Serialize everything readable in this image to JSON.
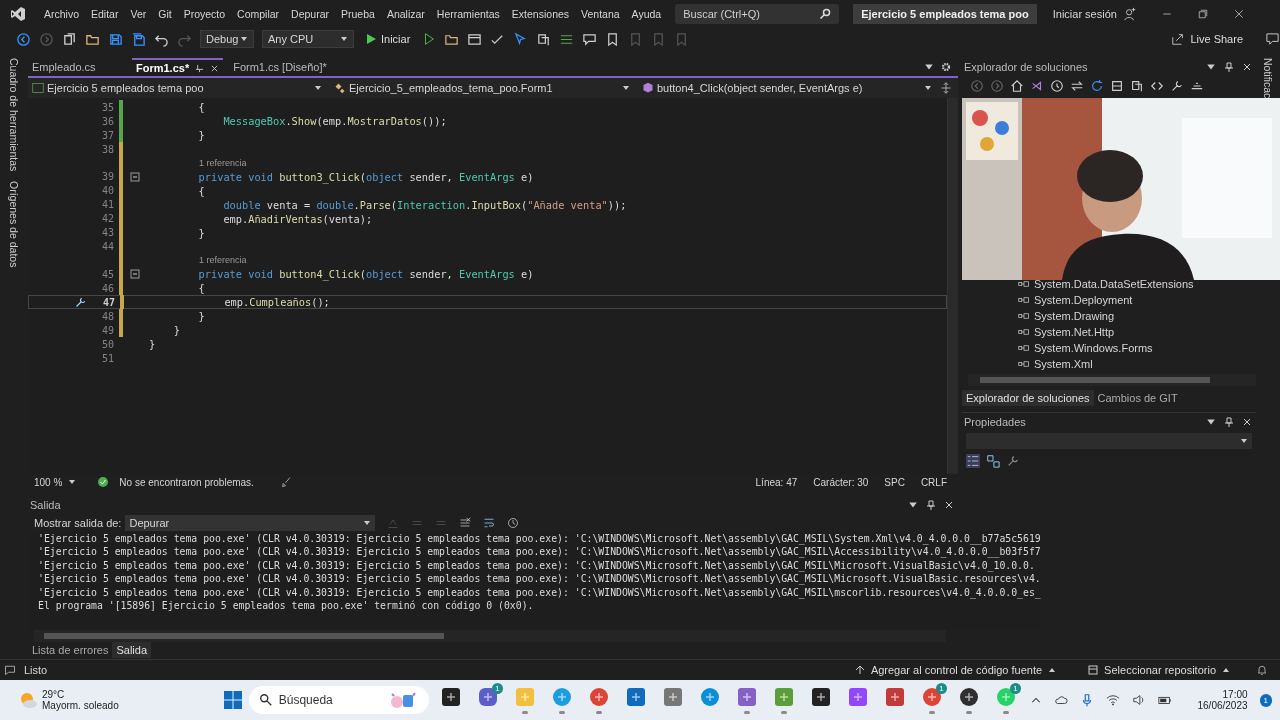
{
  "menu_bar": {
    "items": [
      "Archivo",
      "Editar",
      "Ver",
      "Git",
      "Proyecto",
      "Compilar",
      "Depurar",
      "Prueba",
      "Analizar",
      "Herramientas",
      "Extensiones",
      "Ventana",
      "Ayuda"
    ],
    "search": {
      "placeholder": "Buscar (Ctrl+Q)"
    },
    "solution_name": "Ejercicio 5 empleados tema poo",
    "sign_in": "Iniciar sesión"
  },
  "toolbar": {
    "configuration": "Debug",
    "platform": "Any CPU",
    "start": "Iniciar",
    "live_share": "Live Share"
  },
  "left_rail": [
    "Cuadro de herramientas",
    "Orígenes de datos"
  ],
  "editor": {
    "tabs": [
      {
        "label": "Empleado.cs",
        "selected": false
      },
      {
        "label": "Form1.cs*",
        "selected": true
      },
      {
        "label": "Form1.cs [Diseño]*",
        "selected": false
      }
    ],
    "nav": {
      "project": "Ejercicio 5 empleados tema poo",
      "class": "Ejercicio_5_empleados_tema_poo.Form1",
      "member": "button4_Click(object sender, EventArgs e)"
    },
    "lines": [
      {
        "kind": "code",
        "number": "35",
        "current": false,
        "fold": false,
        "changed": true,
        "saved": true,
        "tokens": [
          {
            "kind": "plain",
            "text": "        {"
          }
        ]
      },
      {
        "kind": "code",
        "number": "36",
        "current": false,
        "fold": false,
        "changed": true,
        "saved": true,
        "tokens": [
          {
            "kind": "type",
            "text": "            MessageBox"
          },
          {
            "kind": "plain",
            "text": "."
          },
          {
            "kind": "method",
            "text": "Show"
          },
          {
            "kind": "plain",
            "text": "(emp."
          },
          {
            "kind": "method",
            "text": "MostrarDatos"
          },
          {
            "kind": "plain",
            "text": "());"
          }
        ]
      },
      {
        "kind": "code",
        "number": "37",
        "current": false,
        "fold": false,
        "changed": true,
        "saved": true,
        "tokens": [
          {
            "kind": "plain",
            "text": "        }"
          }
        ]
      },
      {
        "kind": "code",
        "number": "38",
        "current": false,
        "fold": false,
        "changed": true,
        "saved": false
      },
      {
        "kind": "codelens",
        "text": "1 referencia"
      },
      {
        "kind": "code",
        "number": "39",
        "current": false,
        "fold": true,
        "changed": true,
        "saved": false,
        "tokens": [
          {
            "kind": "keyword",
            "text": "        private void "
          },
          {
            "kind": "method",
            "text": "button3_Click"
          },
          {
            "kind": "plain",
            "text": "("
          },
          {
            "kind": "keyword",
            "text": "object"
          },
          {
            "kind": "plain",
            "text": " sender, "
          },
          {
            "kind": "type",
            "text": "EventArgs"
          },
          {
            "kind": "plain",
            "text": " e)"
          }
        ]
      },
      {
        "kind": "code",
        "number": "40",
        "current": false,
        "fold": false,
        "changed": true,
        "saved": false,
        "tokens": [
          {
            "kind": "plain",
            "text": "        {"
          }
        ]
      },
      {
        "kind": "code",
        "number": "41",
        "current": false,
        "fold": false,
        "changed": true,
        "saved": false,
        "tokens": [
          {
            "kind": "keyword",
            "text": "            double"
          },
          {
            "kind": "plain",
            "text": " venta = "
          },
          {
            "kind": "keyword",
            "text": "double"
          },
          {
            "kind": "plain",
            "text": "."
          },
          {
            "kind": "method",
            "text": "Parse"
          },
          {
            "kind": "plain",
            "text": "("
          },
          {
            "kind": "type",
            "text": "Interaction"
          },
          {
            "kind": "plain",
            "text": "."
          },
          {
            "kind": "method",
            "text": "InputBox"
          },
          {
            "kind": "plain",
            "text": "("
          },
          {
            "kind": "string",
            "text": "\"Añade venta\""
          },
          {
            "kind": "plain",
            "text": "));"
          }
        ]
      },
      {
        "kind": "code",
        "number": "42",
        "current": false,
        "fold": false,
        "changed": true,
        "saved": false,
        "tokens": [
          {
            "kind": "plain",
            "text": "            emp."
          },
          {
            "kind": "method",
            "text": "AñadirVentas"
          },
          {
            "kind": "plain",
            "text": "(venta);"
          }
        ]
      },
      {
        "kind": "code",
        "number": "43",
        "current": false,
        "fold": false,
        "changed": true,
        "saved": false,
        "tokens": [
          {
            "kind": "plain",
            "text": "        }"
          }
        ]
      },
      {
        "kind": "code",
        "number": "44",
        "current": false,
        "fold": false,
        "changed": true,
        "saved": false
      },
      {
        "kind": "codelens",
        "text": "1 referencia"
      },
      {
        "kind": "code",
        "number": "45",
        "current": false,
        "fold": true,
        "changed": true,
        "saved": false,
        "tokens": [
          {
            "kind": "keyword",
            "text": "        private void "
          },
          {
            "kind": "method",
            "text": "button4_Click"
          },
          {
            "kind": "plain",
            "text": "("
          },
          {
            "kind": "keyword",
            "text": "object"
          },
          {
            "kind": "plain",
            "text": " sender, "
          },
          {
            "kind": "type",
            "text": "EventArgs"
          },
          {
            "kind": "plain",
            "text": " e)"
          }
        ]
      },
      {
        "kind": "code",
        "number": "46",
        "current": false,
        "fold": false,
        "changed": true,
        "saved": false,
        "tokens": [
          {
            "kind": "plain",
            "text": "        {"
          }
        ]
      },
      {
        "kind": "code",
        "number": "47",
        "current": true,
        "fold": false,
        "changed": true,
        "saved": false,
        "tokens": [
          {
            "kind": "plain",
            "text": "            emp."
          },
          {
            "kind": "method",
            "text": "Cumpleaños"
          },
          {
            "kind": "plain",
            "text": "();"
          }
        ]
      },
      {
        "kind": "code",
        "number": "48",
        "current": false,
        "fold": false,
        "changed": true,
        "saved": false,
        "tokens": [
          {
            "kind": "plain",
            "text": "        }"
          }
        ]
      },
      {
        "kind": "code",
        "number": "49",
        "current": false,
        "fold": false,
        "changed": true,
        "saved": false,
        "tokens": [
          {
            "kind": "plain",
            "text": "    }"
          }
        ]
      },
      {
        "kind": "code",
        "number": "50",
        "current": false,
        "fold": false,
        "changed": false,
        "tokens": [
          {
            "kind": "plain",
            "text": "}"
          }
        ]
      },
      {
        "kind": "code",
        "number": "51",
        "current": false,
        "fold": false,
        "changed": false
      }
    ],
    "status": {
      "zoom": "100 %",
      "issues": "No se encontraron problemas.",
      "line": "Línea: 47",
      "column": "Carácter: 30",
      "whitespace": "SPC",
      "line_ending": "CRLF"
    }
  },
  "solution_explorer": {
    "title": "Explorador de soluciones",
    "items": [
      "System.Data.DataSetExtensions",
      "System.Deployment",
      "System.Drawing",
      "System.Net.Http",
      "System.Windows.Forms",
      "System.Xml"
    ],
    "tabs": [
      {
        "label": "Explorador de soluciones",
        "selected": true
      },
      {
        "label": "Cambios de GIT",
        "selected": false
      }
    ]
  },
  "webcam": {
    "kind": "picture"
  },
  "properties": {
    "title": "Propiedades"
  },
  "right_rail": "Notificac",
  "output": {
    "title": "Salida",
    "source_label": "Mostrar salida de:",
    "source": "Depurar",
    "lines": [
      "'Ejercicio 5 empleados tema poo.exe' (CLR v4.0.30319: Ejercicio 5 empleados tema poo.exe): 'C:\\WINDOWS\\Microsoft.Net\\assembly\\GAC_MSIL\\System.Xml\\v4.0_4.0.0.0__b77a5c5619",
      "'Ejercicio 5 empleados tema poo.exe' (CLR v4.0.30319: Ejercicio 5 empleados tema poo.exe): 'C:\\WINDOWS\\Microsoft.Net\\assembly\\GAC_MSIL\\Accessibility\\v4.0_4.0.0.0__b03f5f7",
      "'Ejercicio 5 empleados tema poo.exe' (CLR v4.0.30319: Ejercicio 5 empleados tema poo.exe): 'C:\\WINDOWS\\Microsoft.Net\\assembly\\GAC_MSIL\\Microsoft.VisualBasic\\v4.0_10.0.0.",
      "'Ejercicio 5 empleados tema poo.exe' (CLR v4.0.30319: Ejercicio 5 empleados tema poo.exe): 'C:\\WINDOWS\\Microsoft.Net\\assembly\\GAC_MSIL\\Microsoft.VisualBasic.resources\\v4.",
      "'Ejercicio 5 empleados tema poo.exe' (CLR v4.0.30319: Ejercicio 5 empleados tema poo.exe): 'C:\\WINDOWS\\Microsoft.Net\\assembly\\GAC_MSIL\\mscorlib.resources\\v4.0_4.0.0.0_es_",
      "El programa '[15896] Ejercicio 5 empleados tema poo.exe' terminó con código 0 (0x0)."
    ]
  },
  "bottom_tabs": [
    {
      "label": "Lista de errores",
      "selected": false
    },
    {
      "label": "Salida",
      "selected": true
    }
  ],
  "status_bar": {
    "state": "Listo",
    "source_control": "Agregar al control de código fuente",
    "repository": "Seleccionar repositorio"
  },
  "taskbar": {
    "weather": {
      "temperature": "29°C",
      "condition": "Mayorm. soleado"
    },
    "search": {
      "placeholder": "Búsqueda"
    },
    "apps": [
      {
        "running": false
      },
      {
        "running": false,
        "badge": "1"
      },
      {
        "running": true
      },
      {
        "running": true
      },
      {
        "running": true
      },
      {
        "running": false
      },
      {
        "running": false
      },
      {
        "running": false
      },
      {
        "running": true
      },
      {
        "running": true
      },
      {
        "running": false
      },
      {
        "running": false
      },
      {
        "running": false
      },
      {
        "running": true,
        "badge": "1"
      },
      {
        "running": true
      },
      {
        "running": true,
        "badge": "1"
      }
    ],
    "time": "17:00",
    "date": "16/06/2023",
    "notifications": "1"
  }
}
